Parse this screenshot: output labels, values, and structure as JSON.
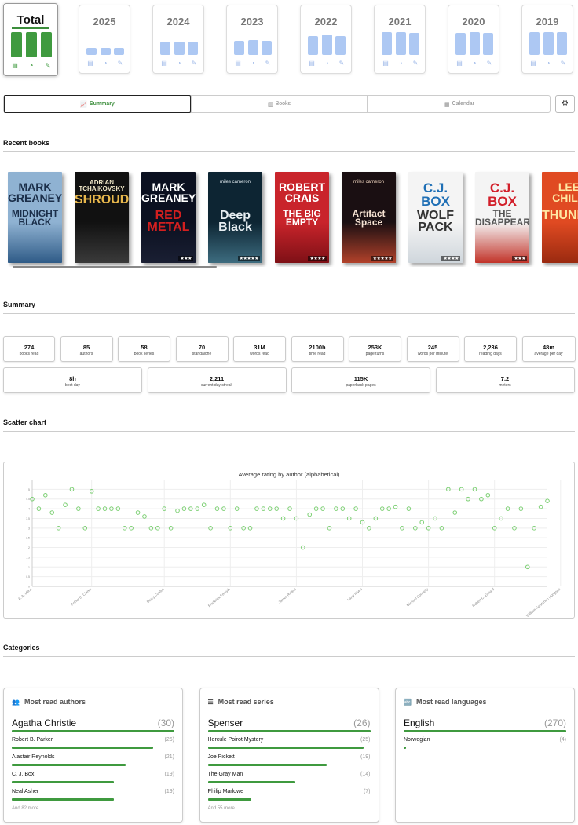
{
  "years": [
    {
      "label": "Total",
      "active": true,
      "bars": [
        1,
        1,
        1
      ]
    },
    {
      "label": "2025",
      "active": false,
      "bars": [
        0.18,
        0.18,
        0.18
      ]
    },
    {
      "label": "2024",
      "active": false,
      "bars": [
        0.45,
        0.45,
        0.45
      ]
    },
    {
      "label": "2023",
      "active": false,
      "bars": [
        0.5,
        0.55,
        0.5
      ]
    },
    {
      "label": "2022",
      "active": false,
      "bars": [
        0.7,
        0.8,
        0.72
      ]
    },
    {
      "label": "2021",
      "active": false,
      "bars": [
        0.9,
        0.9,
        0.85
      ]
    },
    {
      "label": "2020",
      "active": false,
      "bars": [
        0.85,
        0.9,
        0.85
      ]
    },
    {
      "label": "2019",
      "active": false,
      "bars": [
        0.9,
        0.9,
        0.9
      ]
    }
  ],
  "tabs": [
    {
      "label": "Summary",
      "icon": "chart-line-icon",
      "active": true
    },
    {
      "label": "Books",
      "icon": "books-icon",
      "active": false
    },
    {
      "label": "Calendar",
      "icon": "calendar-icon",
      "active": false
    }
  ],
  "sections": {
    "recent": "Recent books",
    "summary": "Summary",
    "scatter": "Scatter chart",
    "categories": "Categories"
  },
  "books": [
    {
      "author": "MARK GREANEY",
      "title": "MIDNIGHT BLACK",
      "bg": "#8fb2d2",
      "fg": "#1b2f4a",
      "tc": "#1b2f4a",
      "stars": "",
      "accent": "#2f5b87"
    },
    {
      "author": "ADRIAN TCHAIKOVSKY",
      "title": "SHROUD",
      "bg": "#111111",
      "fg": "#f2e9c9",
      "tc": "#e8b84c",
      "stars": "",
      "accent": "#3a3a3a"
    },
    {
      "author": "MARK GREANEY",
      "title": "RED METAL",
      "bg": "#0b1020",
      "fg": "#ffffff",
      "tc": "#d21f1f",
      "stars": "★★★",
      "accent": "#1a1f33"
    },
    {
      "author": "miles cameron",
      "title": "Deep Black",
      "bg": "#0d2533",
      "fg": "#dfe9ee",
      "tc": "#e7eef2",
      "stars": "★★★★★",
      "accent": "#3d6c7f"
    },
    {
      "author": "ROBERT CRAIS",
      "title": "THE BIG EMPTY",
      "bg": "#c9242b",
      "fg": "#ffffff",
      "tc": "#ffffff",
      "stars": "★★★★",
      "accent": "#7e1016"
    },
    {
      "author": "miles cameron",
      "title": "Artifact Space",
      "bg": "#1a0f12",
      "fg": "#f4d8c2",
      "tc": "#f6e2d2",
      "stars": "★★★★★",
      "accent": "#b2412a"
    },
    {
      "author": "C.J. BOX",
      "title": "WOLF PACK",
      "bg": "#f4f4f4",
      "fg": "#1f6fb5",
      "tc": "#333333",
      "stars": "★★★★",
      "accent": "#cfd6dc"
    },
    {
      "author": "C.J. BOX",
      "title": "THE DISAPPEARED",
      "bg": "#f4f4f4",
      "fg": "#d21f2a",
      "tc": "#555555",
      "stars": "★★★",
      "accent": "#c23329"
    },
    {
      "author": "LEE CHILD",
      "title": "THUNDERBOLT",
      "bg": "#e04a22",
      "fg": "#ffe7a3",
      "tc": "#ffe7a3",
      "stars": "",
      "accent": "#9a2a10"
    }
  ],
  "stats_row1": [
    {
      "value": "274",
      "label": "books read"
    },
    {
      "value": "85",
      "label": "authors"
    },
    {
      "value": "58",
      "label": "book series"
    },
    {
      "value": "70",
      "label": "standalone"
    },
    {
      "value": "31M",
      "label": "words read"
    },
    {
      "value": "2100h",
      "label": "time read"
    },
    {
      "value": "253K",
      "label": "page turns"
    },
    {
      "value": "245",
      "label": "words per minute"
    },
    {
      "value": "2,236",
      "label": "reading days"
    },
    {
      "value": "48m",
      "label": "average per day"
    }
  ],
  "stats_row2": [
    {
      "value": "8h",
      "label": "best day"
    },
    {
      "value": "2,211",
      "label": "current day streak"
    },
    {
      "value": "115K",
      "label": "paperback pages"
    },
    {
      "value": "7.2",
      "label": "meters"
    }
  ],
  "chart_data": {
    "type": "scatter",
    "title": "Average rating by author (alphabetical)",
    "ylim": [
      0,
      5.5
    ],
    "yticks": [
      "0",
      "0.5",
      "1",
      "1.5",
      "2",
      "2.5",
      "3",
      "3.5",
      "4",
      "4.5",
      "5"
    ],
    "xtick_labels": [
      "A. A. Milne",
      "Arthur C. Clarke",
      "Darcy Coates",
      "Frederick Forsyth",
      "James Rollins",
      "Larry Niven",
      "Michael Connelly",
      "Robert C. Ennard",
      "William Forstchen Hodgson"
    ],
    "xtick_positions": [
      0,
      9,
      20,
      30,
      40,
      50,
      60,
      70,
      80
    ],
    "grid": true,
    "color": "#7ccf73",
    "y": [
      4.5,
      4.0,
      4.7,
      3.8,
      3.0,
      4.2,
      5.0,
      4.0,
      3.0,
      4.9,
      4.0,
      4.0,
      4.0,
      4.0,
      3.0,
      3.0,
      3.8,
      3.6,
      3.0,
      3.0,
      4.0,
      3.0,
      3.9,
      4.0,
      4.0,
      4.0,
      4.2,
      3.0,
      4.0,
      4.0,
      3.0,
      4.0,
      3.0,
      3.0,
      4.0,
      4.0,
      4.0,
      4.0,
      3.5,
      4.0,
      3.5,
      2.0,
      3.7,
      4.0,
      4.0,
      3.0,
      4.0,
      4.0,
      3.5,
      4.0,
      3.3,
      3.0,
      3.5,
      4.0,
      4.0,
      4.1,
      3.0,
      4.0,
      3.0,
      3.3,
      3.0,
      3.5,
      3.0,
      5.0,
      3.8,
      5.0,
      4.5,
      5.0,
      4.5,
      4.7,
      3.0,
      3.5,
      4.0,
      3.0,
      4.0,
      1.0,
      3.0,
      4.1,
      4.4
    ]
  },
  "categories": [
    {
      "heading": "Most read authors",
      "icon": "people-icon",
      "top": {
        "name": "Agatha Christie",
        "count": "(30)",
        "pct": 1.0
      },
      "rows": [
        {
          "name": "Robert B. Parker",
          "count": "(26)",
          "pct": 0.87
        },
        {
          "name": "Alastair Reynolds",
          "count": "(21)",
          "pct": 0.7
        },
        {
          "name": "C. J. Box",
          "count": "(19)",
          "pct": 0.63
        },
        {
          "name": "Neal Asher",
          "count": "(19)",
          "pct": 0.63
        }
      ],
      "more": "And 82 more"
    },
    {
      "heading": "Most read series",
      "icon": "list-icon",
      "top": {
        "name": "Spenser",
        "count": "(26)",
        "pct": 1.0
      },
      "rows": [
        {
          "name": "Hercule Poirot Mystery",
          "count": "(25)",
          "pct": 0.96
        },
        {
          "name": "Joe Pickett",
          "count": "(19)",
          "pct": 0.73
        },
        {
          "name": "The Gray Man",
          "count": "(14)",
          "pct": 0.54
        },
        {
          "name": "Philip Marlowe",
          "count": "(7)",
          "pct": 0.27
        }
      ],
      "more": "And 55 more"
    },
    {
      "heading": "Most read languages",
      "icon": "language-icon",
      "top": {
        "name": "English",
        "count": "(270)",
        "pct": 1.0
      },
      "rows": [
        {
          "name": "Norwegian",
          "count": "(4)",
          "pct": 0.015
        }
      ],
      "more": ""
    }
  ]
}
